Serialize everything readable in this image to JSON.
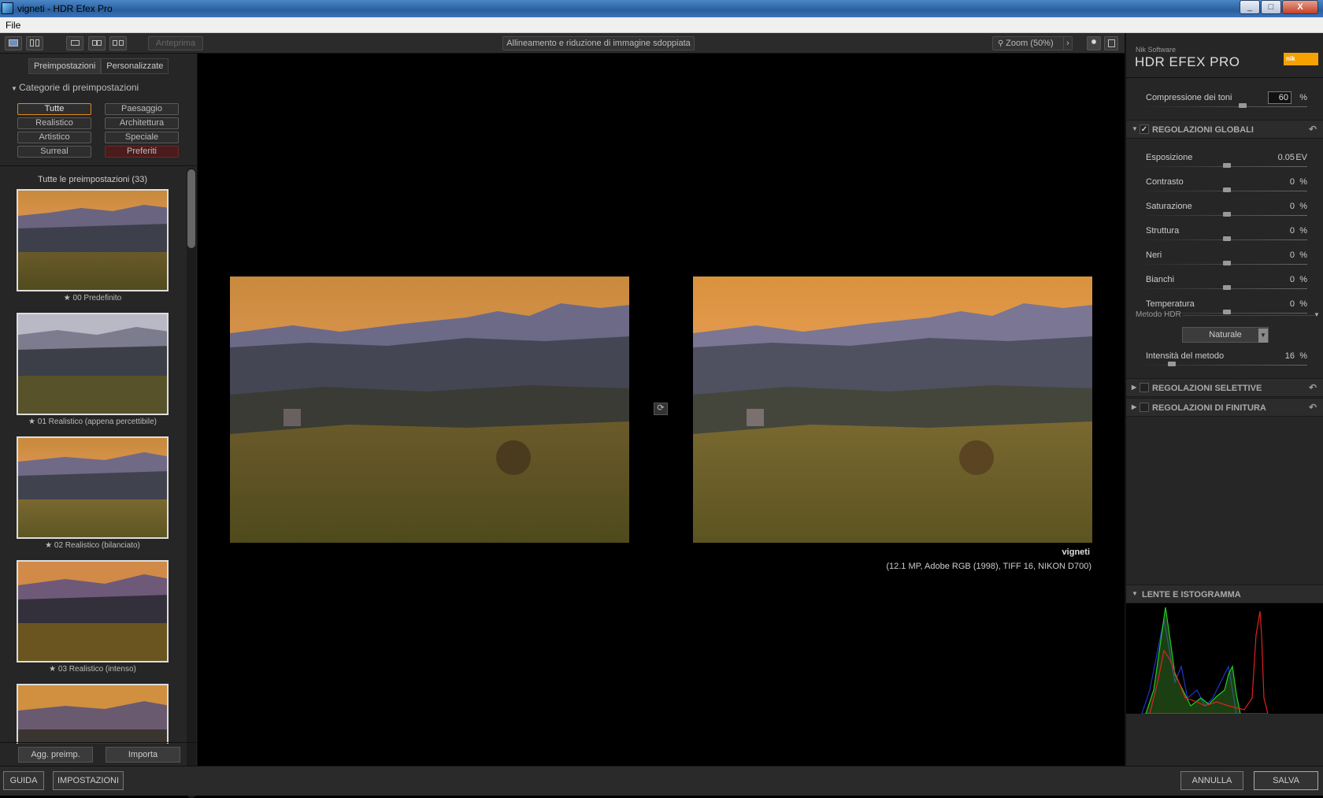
{
  "window": {
    "title": "vigneti - HDR Efex Pro",
    "controls": [
      "_",
      "□",
      "X"
    ]
  },
  "menu": {
    "file": "File"
  },
  "toolbar": {
    "preview": "Anteprima",
    "split_label": "Allineamento e riduzione di immagine sdoppiata",
    "zoom": "Zoom (50%)",
    "zoom_arrow": "›"
  },
  "left": {
    "tabs": [
      "Preimpostazioni",
      "Personalizzate"
    ],
    "category_header": "Categorie di preimpostazioni",
    "categories": [
      "Tutte",
      "Paesaggio",
      "Realistico",
      "Architettura",
      "Artistico",
      "Speciale",
      "Surreal",
      "Preferiti"
    ],
    "list_title": "Tutte le preimpostazioni (33)",
    "presets": [
      "★ 00 Predefinito",
      "★ 01 Realistico (appena percettibile)",
      "★ 02 Realistico (bilanciato)",
      "★ 03 Realistico (intenso)"
    ],
    "add_button": "Agg. preimp.",
    "import_button": "Importa"
  },
  "center": {
    "image_name": "vigneti",
    "image_info": "(12.1 MP, Adobe RGB (1998), TIFF 16, NIKON D700)"
  },
  "right": {
    "brand_small": "Nik Software",
    "brand_large": "HDR EFEX PRO",
    "brand_logo": "nik",
    "tone_compression": {
      "label": "Compressione dei toni",
      "value": "60",
      "unit": "%",
      "level": 0.6
    },
    "global_section": "REGOLAZIONI GLOBALI",
    "global_check": "✓",
    "sliders": [
      {
        "label": "Esposizione",
        "value": "0.05",
        "unit": "EV",
        "level": 0.5
      },
      {
        "label": "Contrasto",
        "value": "0",
        "unit": "%",
        "level": 0.5
      },
      {
        "label": "Saturazione",
        "value": "0",
        "unit": "%",
        "level": 0.5
      },
      {
        "label": "Struttura",
        "value": "0",
        "unit": "%",
        "level": 0.5
      },
      {
        "label": "Neri",
        "value": "0",
        "unit": "%",
        "level": 0.5
      },
      {
        "label": "Bianchi",
        "value": "0",
        "unit": "%",
        "level": 0.5
      },
      {
        "label": "Temperatura",
        "value": "0",
        "unit": "%",
        "level": 0.5
      }
    ],
    "hdr_method_label": "Metodo HDR",
    "hdr_method_value": "Naturale",
    "method_intensity": {
      "label": "Intensità del metodo",
      "value": "16",
      "unit": "%",
      "level": 0.16
    },
    "selective_section": "REGOLAZIONI SELETTIVE",
    "finishing_section": "REGOLAZIONI DI FINITURA",
    "histogram_section": "LENTE E ISTOGRAMMA"
  },
  "bottom": {
    "help": "GUIDA",
    "settings": "IMPOSTAZIONI",
    "cancel": "ANNULLA",
    "save": "SALVA"
  }
}
